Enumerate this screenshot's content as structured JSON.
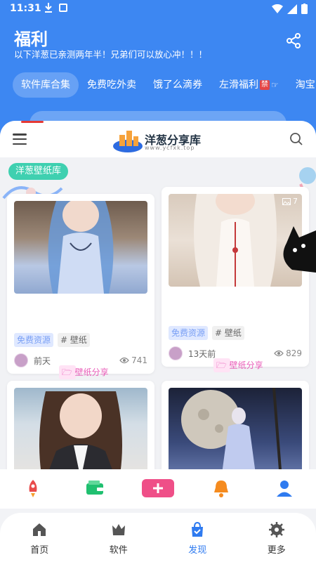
{
  "status": {
    "time": "11:31"
  },
  "header": {
    "title": "福利",
    "subtitle": "以下洋葱已亲测两年半！兄弟们可以放心冲！！！",
    "tabs": [
      {
        "label": "软件库合集",
        "active": true
      },
      {
        "label": "免费吃外卖",
        "active": false
      },
      {
        "label": "饿了么滴券",
        "active": false
      },
      {
        "label": "左滑福利",
        "active": false,
        "badge": "禁"
      },
      {
        "label": "淘宝",
        "active": false
      }
    ]
  },
  "site": {
    "name": "洋葱分享库",
    "domain": "www.ycfxk.top"
  },
  "section": {
    "tag": "洋葱壁纸库"
  },
  "cards": [
    {
      "tag_free": "免费资源",
      "tag_share": "壁纸分享",
      "tag_hash": "# 壁纸",
      "time": "前天",
      "views": "741"
    },
    {
      "photo_count": "7",
      "tag_free": "免费资源",
      "tag_share": "壁纸分享",
      "tag_hash": "# 壁纸",
      "time": "13天前",
      "views": "829"
    }
  ],
  "nav": {
    "items": [
      {
        "label": "首页",
        "icon": "home-icon"
      },
      {
        "label": "软件",
        "icon": "crown-icon"
      },
      {
        "label": "发现",
        "icon": "bag-icon",
        "active": true
      },
      {
        "label": "更多",
        "icon": "gear-icon"
      }
    ]
  },
  "colors": {
    "primary": "#3d87f2",
    "accent": "#2f7bf0",
    "tag_teal": "#3fd0b0"
  }
}
